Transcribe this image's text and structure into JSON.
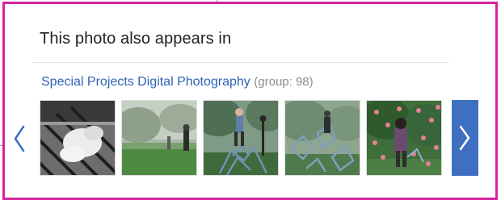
{
  "panel": {
    "title": "This photo also appears in"
  },
  "group": {
    "name": "Special Projects Digital Photography",
    "meta": "(group: 98)"
  },
  "carousel": {
    "thumbnails": [
      {
        "subject": "black-and-white person lying on striped fabric"
      },
      {
        "subject": "figures standing in misty green park"
      },
      {
        "subject": "person jumping on pile of chairs under trees"
      },
      {
        "subject": "chairs flying across misty park"
      },
      {
        "subject": "woman in tree with pink flowers"
      }
    ],
    "prev_icon": "chevron-left-icon",
    "next_icon": "chevron-right-icon"
  },
  "colors": {
    "highlight_border": "#d6249f",
    "link": "#2f62b4",
    "next_button": "#3f6fc0"
  }
}
